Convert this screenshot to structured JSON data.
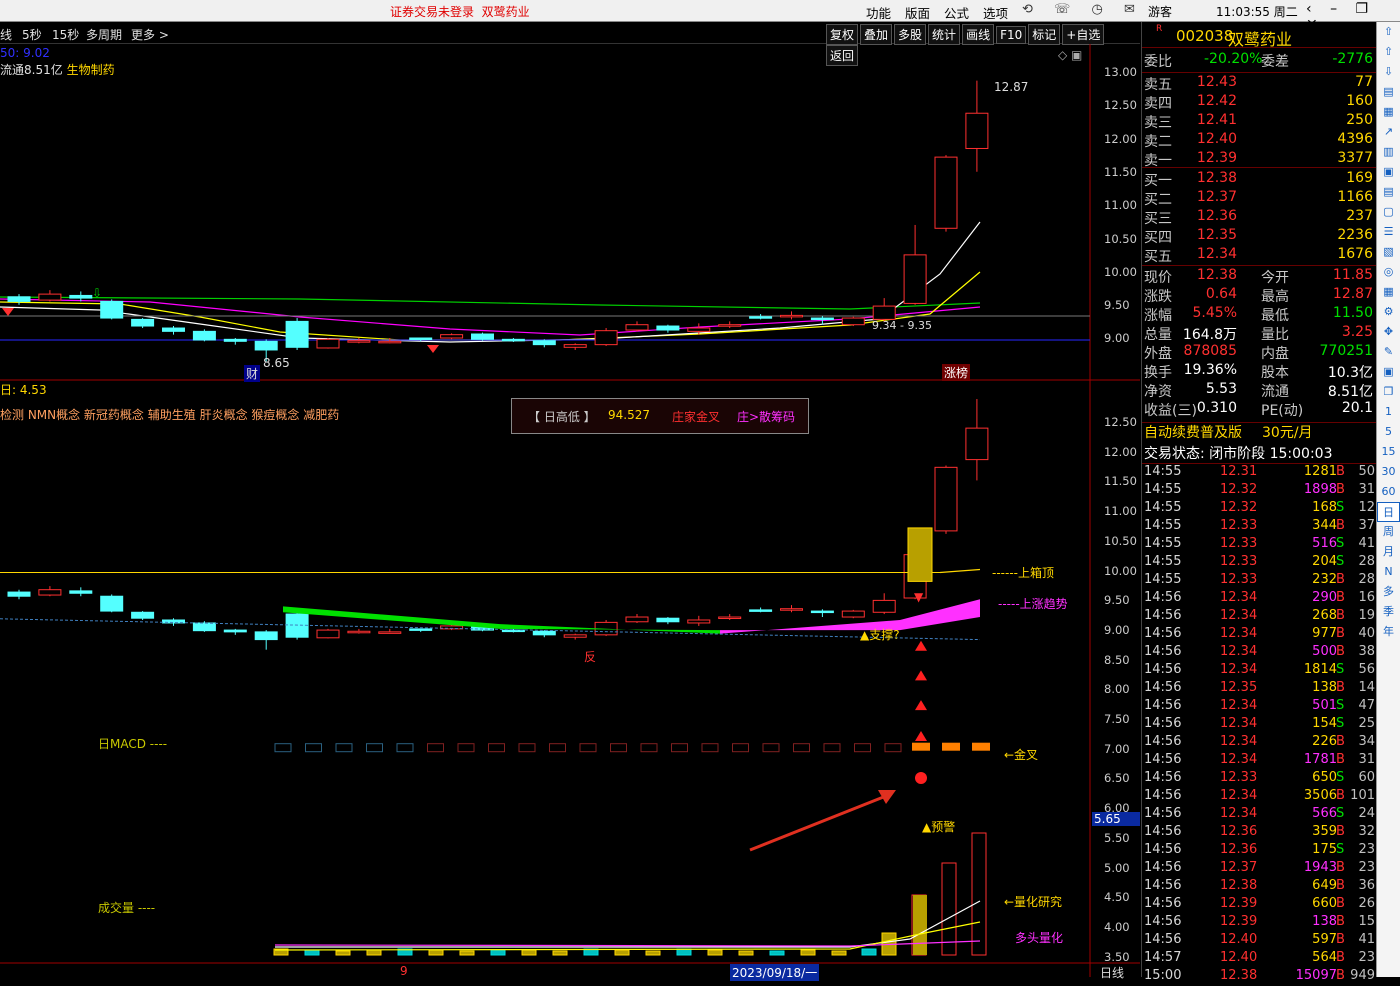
{
  "topbar": {
    "notice": "证券交易未登录",
    "stock_name": "双鹭药业",
    "menu": [
      "功能",
      "版面",
      "公式",
      "选项"
    ],
    "guest": "游客",
    "clock": "11:03:55 周二"
  },
  "period": {
    "items": [
      "线",
      "5秒",
      "15秒",
      "多周期",
      "更多 >"
    ]
  },
  "tools": [
    "复权",
    "叠加",
    "多股",
    "统计",
    "画线",
    "F10",
    "标记",
    "+自选",
    "返回"
  ],
  "chart1": {
    "ma_label": "50: 9.02",
    "info": "流通8.51亿",
    "sector": "生物制药",
    "high_label": "12.87",
    "low_label": "8.65",
    "ma_range": "9.34 - 9.35",
    "cai": "财",
    "zhangbang": "涨榜",
    "axis": [
      "13.00",
      "12.50",
      "12.00",
      "11.50",
      "11.00",
      "10.50",
      "10.00",
      "9.50",
      "9.00"
    ]
  },
  "chart2": {
    "title": "日: 4.53",
    "concepts": "检测 NMN概念 新冠药概念 辅助生殖 肝炎概念 猴痘概念 减肥药",
    "infobox": {
      "a": "【 日高低 】",
      "b": "94.527",
      "c": "庄家金叉",
      "d": "庄>散筹码"
    },
    "axis": [
      "12.50",
      "12.00",
      "11.50",
      "11.00",
      "10.50",
      "10.00",
      "9.50",
      "9.00",
      "8.50",
      "8.00",
      "7.50",
      "7.00",
      "6.50",
      "6.00",
      "5.50",
      "5.00",
      "4.50",
      "4.00",
      "3.50"
    ],
    "marker": "5.65",
    "labels": {
      "box_top": "上箱顶",
      "trend": "上涨趋势",
      "support": "▲支撑?",
      "fan": "反",
      "macd": "日MACD ----",
      "golden": "←金叉",
      "warn": "▲预警",
      "vol": "成交量 ----",
      "quant": "←量化研究",
      "bull": "多头量化"
    }
  },
  "bottom": {
    "month": "9",
    "date": "2023/09/18/一",
    "daily": "日线"
  },
  "quote": {
    "code": "002038",
    "name": "双鹭药业",
    "weibi": {
      "l": "委比",
      "v": "-20.20%",
      "l2": "委差",
      "v2": "-2776"
    },
    "asks": [
      {
        "l": "卖五",
        "p": "12.43",
        "v": "77"
      },
      {
        "l": "卖四",
        "p": "12.42",
        "v": "160"
      },
      {
        "l": "卖三",
        "p": "12.41",
        "v": "250"
      },
      {
        "l": "卖二",
        "p": "12.40",
        "v": "4396"
      },
      {
        "l": "卖一",
        "p": "12.39",
        "v": "3377"
      }
    ],
    "bids": [
      {
        "l": "买一",
        "p": "12.38",
        "v": "169"
      },
      {
        "l": "买二",
        "p": "12.37",
        "v": "1166"
      },
      {
        "l": "买三",
        "p": "12.36",
        "v": "237"
      },
      {
        "l": "买四",
        "p": "12.35",
        "v": "2236"
      },
      {
        "l": "买五",
        "p": "12.34",
        "v": "1676"
      }
    ],
    "stats": [
      {
        "l": "现价",
        "v": "12.38",
        "l2": "今开",
        "v2": "11.85"
      },
      {
        "l": "涨跌",
        "v": "0.64",
        "l2": "最高",
        "v2": "12.87"
      },
      {
        "l": "涨幅",
        "v": "5.45%",
        "l2": "最低",
        "v2": "11.50"
      },
      {
        "l": "总量",
        "v": "164.8万",
        "l2": "量比",
        "v2": "3.25"
      },
      {
        "l": "外盘",
        "v": "878085",
        "l2": "内盘",
        "v2": "770251"
      },
      {
        "l": "换手",
        "v": "19.36%",
        "l2": "股本",
        "v2": "10.3亿"
      },
      {
        "l": "净资",
        "v": "5.53",
        "l2": "流通",
        "v2": "8.51亿"
      },
      {
        "l": "收益(三)",
        "v": "0.310",
        "l2": "PE(动)",
        "v2": "20.1"
      }
    ],
    "promo": "自动续费普及版",
    "promo_price": "30元/月",
    "trade_status": "交易状态: 闭市阶段 15:00:03"
  },
  "ticks": [
    {
      "t": "14:55",
      "p": "12.31",
      "v": "1281",
      "s": "B",
      "n": "50"
    },
    {
      "t": "14:55",
      "p": "12.32",
      "v": "1898",
      "s": "B",
      "n": "31"
    },
    {
      "t": "14:55",
      "p": "12.32",
      "v": "168",
      "s": "S",
      "n": "12"
    },
    {
      "t": "14:55",
      "p": "12.33",
      "v": "344",
      "s": "B",
      "n": "37"
    },
    {
      "t": "14:55",
      "p": "12.33",
      "v": "516",
      "s": "S",
      "n": "41"
    },
    {
      "t": "14:55",
      "p": "12.33",
      "v": "204",
      "s": "S",
      "n": "28"
    },
    {
      "t": "14:55",
      "p": "12.33",
      "v": "232",
      "s": "B",
      "n": "28"
    },
    {
      "t": "14:56",
      "p": "12.34",
      "v": "290",
      "s": "B",
      "n": "16"
    },
    {
      "t": "14:56",
      "p": "12.34",
      "v": "268",
      "s": "B",
      "n": "19"
    },
    {
      "t": "14:56",
      "p": "12.34",
      "v": "977",
      "s": "B",
      "n": "40"
    },
    {
      "t": "14:56",
      "p": "12.34",
      "v": "500",
      "s": "B",
      "n": "38"
    },
    {
      "t": "14:56",
      "p": "12.34",
      "v": "1814",
      "s": "S",
      "n": "56"
    },
    {
      "t": "14:56",
      "p": "12.35",
      "v": "138",
      "s": "B",
      "n": "14"
    },
    {
      "t": "14:56",
      "p": "12.34",
      "v": "501",
      "s": "S",
      "n": "47"
    },
    {
      "t": "14:56",
      "p": "12.34",
      "v": "154",
      "s": "S",
      "n": "25"
    },
    {
      "t": "14:56",
      "p": "12.34",
      "v": "226",
      "s": "B",
      "n": "34"
    },
    {
      "t": "14:56",
      "p": "12.34",
      "v": "1781",
      "s": "B",
      "n": "31"
    },
    {
      "t": "14:56",
      "p": "12.33",
      "v": "650",
      "s": "S",
      "n": "60"
    },
    {
      "t": "14:56",
      "p": "12.34",
      "v": "3506",
      "s": "B",
      "n": "101"
    },
    {
      "t": "14:56",
      "p": "12.34",
      "v": "566",
      "s": "S",
      "n": "24"
    },
    {
      "t": "14:56",
      "p": "12.36",
      "v": "359",
      "s": "B",
      "n": "32"
    },
    {
      "t": "14:56",
      "p": "12.36",
      "v": "175",
      "s": "S",
      "n": "23"
    },
    {
      "t": "14:56",
      "p": "12.37",
      "v": "1943",
      "s": "B",
      "n": "23"
    },
    {
      "t": "14:56",
      "p": "12.38",
      "v": "649",
      "s": "B",
      "n": "36"
    },
    {
      "t": "14:56",
      "p": "12.39",
      "v": "660",
      "s": "B",
      "n": "26"
    },
    {
      "t": "14:56",
      "p": "12.39",
      "v": "138",
      "s": "B",
      "n": "15"
    },
    {
      "t": "14:56",
      "p": "12.40",
      "v": "597",
      "s": "B",
      "n": "41"
    },
    {
      "t": "14:57",
      "p": "12.40",
      "v": "564",
      "s": "B",
      "n": "23"
    },
    {
      "t": "15:00",
      "p": "12.38",
      "v": "15097",
      "s": "B",
      "n": "949"
    }
  ],
  "sidebar": {
    "nums": [
      "1",
      "5",
      "15",
      "30",
      "60"
    ],
    "periods": [
      "日",
      "周",
      "月",
      "N",
      "多",
      "季",
      "年"
    ]
  },
  "colors": {
    "up": "#ff3030",
    "down": "#54ffff",
    "ma_white": "#ffffff",
    "ma_yellow": "#ffff00",
    "ma_magenta": "#ff00ff",
    "ma_green": "#00d000",
    "axis_red": "#a00000"
  }
}
